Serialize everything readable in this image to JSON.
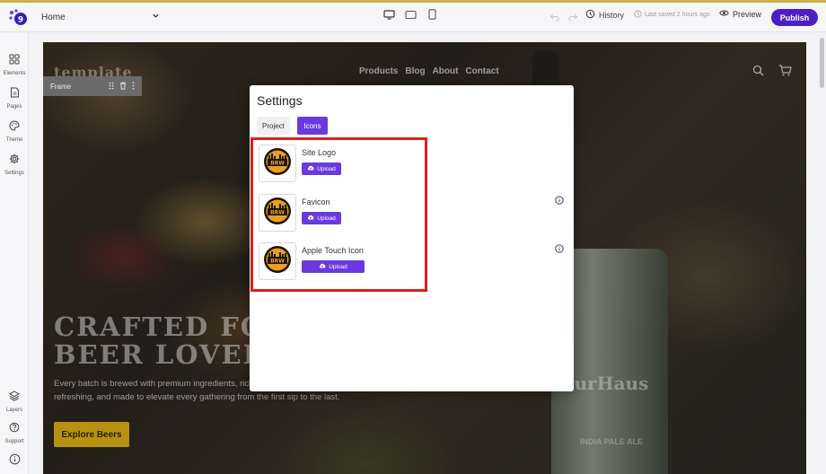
{
  "topbar": {
    "page_name": "Home",
    "history_label": "History",
    "last_saved": "Last saved 2 hours ago",
    "preview_label": "Preview",
    "publish_label": "Publish"
  },
  "sidebar": {
    "items": [
      {
        "label": "Elements",
        "icon": "grid-icon"
      },
      {
        "label": "Pages",
        "icon": "page-icon"
      },
      {
        "label": "Theme",
        "icon": "palette-icon"
      },
      {
        "label": "Settings",
        "icon": "gear-icon"
      },
      {
        "label": "Layers",
        "icon": "layers-icon"
      },
      {
        "label": "Support",
        "icon": "help-icon"
      }
    ]
  },
  "canvas": {
    "logo_text": "template",
    "nav": [
      "Products",
      "Blog",
      "About",
      "Contact"
    ],
    "frame_label": "Frame",
    "hero_title_1": "CRAFTED FOR",
    "hero_title_2": "BEER LOVERS",
    "hero_subtitle": "Every batch is brewed with premium ingredients, rich in flavor, passion. Crisp, refreshing, and made to elevate every gathering from the first sip to the last.",
    "hero_button": "Explore Beers",
    "can_text": "urHaus",
    "can_subtext": "INDIA PALE ALE"
  },
  "modal": {
    "title": "Settings",
    "tabs": [
      {
        "label": "Project",
        "active": false
      },
      {
        "label": "Icons",
        "active": true
      }
    ],
    "rows": [
      {
        "label": "Site Logo",
        "button": "Upload"
      },
      {
        "label": "Favicon",
        "button": "Upload"
      },
      {
        "label": "Apple Touch Icon",
        "button": "Upload"
      }
    ]
  },
  "colors": {
    "accent": "#6a3ae0",
    "publish": "#4b1fc4",
    "highlight": "#e11d1d",
    "hero_button": "#b8910e"
  }
}
